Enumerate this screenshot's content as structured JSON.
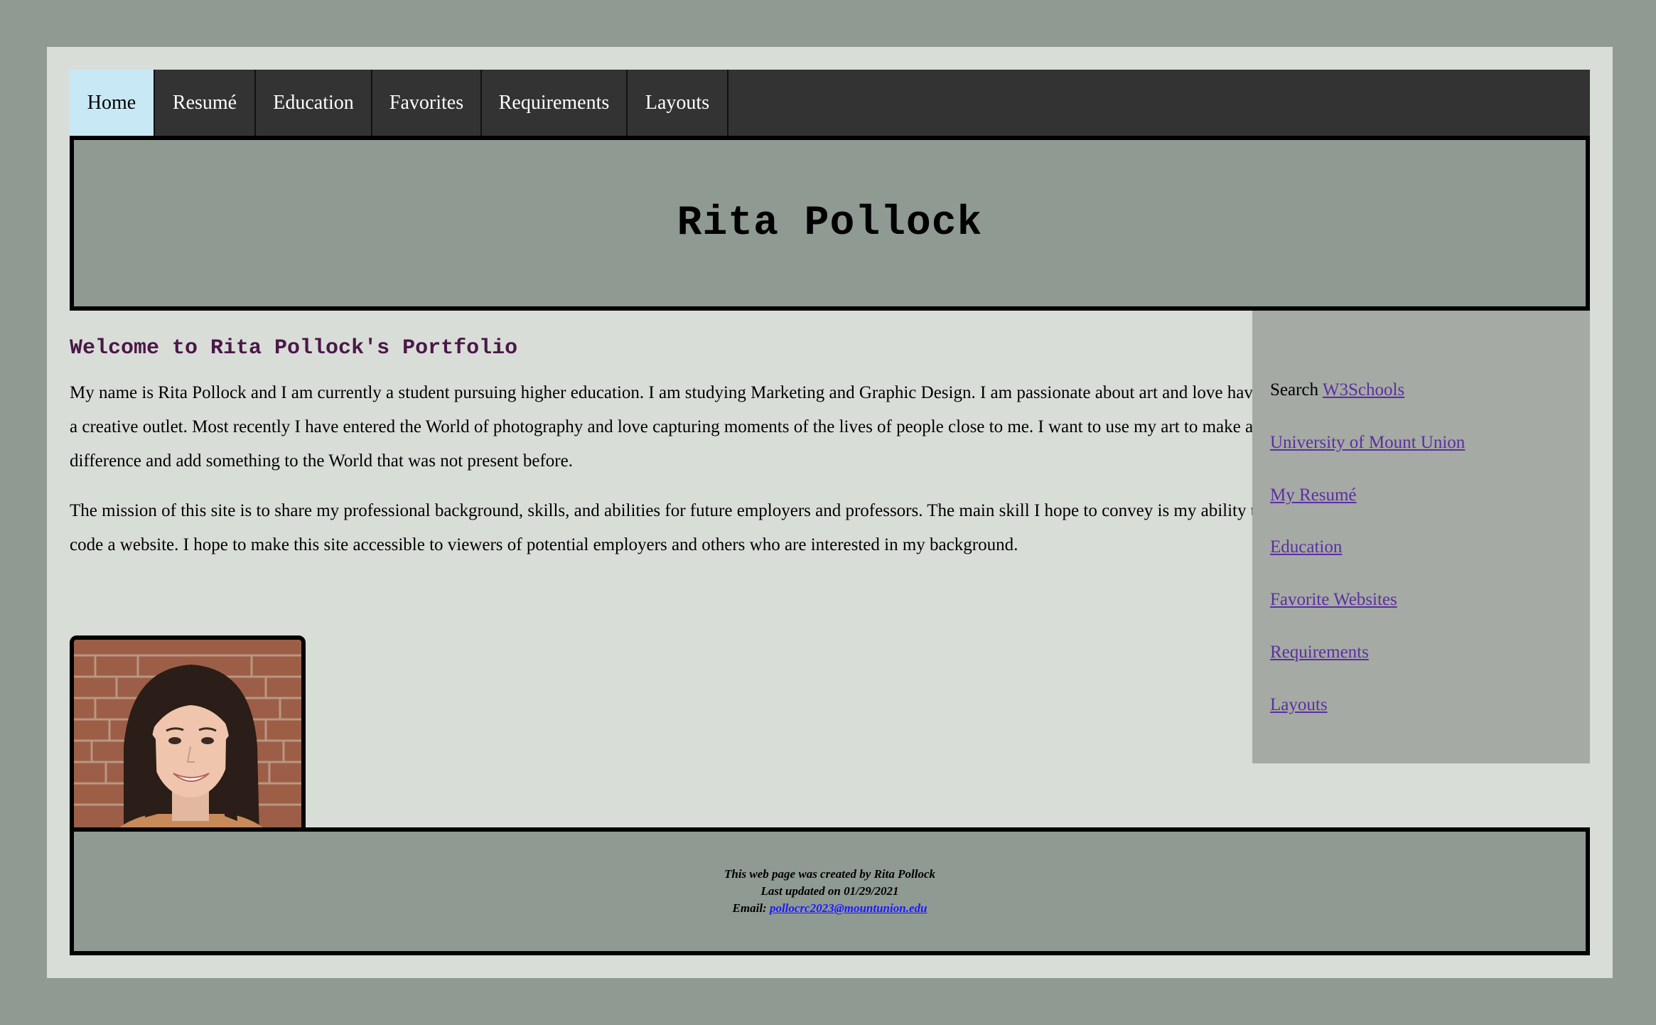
{
  "nav": {
    "items": [
      {
        "label": "Home"
      },
      {
        "label": "Resumé"
      },
      {
        "label": "Education"
      },
      {
        "label": "Favorites"
      },
      {
        "label": "Requirements"
      },
      {
        "label": "Layouts"
      }
    ]
  },
  "header": {
    "title": "Rita Pollock"
  },
  "main": {
    "heading": "Welcome to Rita Pollock's Portfolio",
    "paragraph1": "My name is Rita Pollock and I am currently a student pursuing higher education. I am studying Marketing and Graphic Design. I am passionate about art and love having a creative outlet. Most recently I have entered the World of photography and love capturing moments of the lives of people close to me. I want to use my art to make a difference and add something to the World that was not present before.",
    "paragraph2": "The mission of this site is to share my professional background, skills, and abilities for future employers and professors. The main skill I hope to convey is my ability to code a website. I hope to make this site accessible to viewers of potential employers and others who are interested in my background."
  },
  "sidebar": {
    "search_prefix": "Search",
    "search_link": "W3Schools",
    "links": [
      {
        "label": "University of Mount Union"
      },
      {
        "label": "My Resumé"
      },
      {
        "label": "Education"
      },
      {
        "label": "Favorite Websites"
      },
      {
        "label": "Requirements"
      },
      {
        "label": "Layouts"
      }
    ]
  },
  "footer": {
    "line1": "This web page was created by Rita Pollock",
    "line2": "Last updated on 01/29/2021",
    "email_prefix": "Email:",
    "email": "pollocrc2023@mountunion.edu"
  },
  "colors": {
    "background": "#8f9a92",
    "page": "#d9ddd8",
    "nav": "#333333",
    "nav_active": "#c8e8f6",
    "heading": "#4a1848",
    "sidebar": "#a5aaa5",
    "link": "#5b2fa0"
  }
}
